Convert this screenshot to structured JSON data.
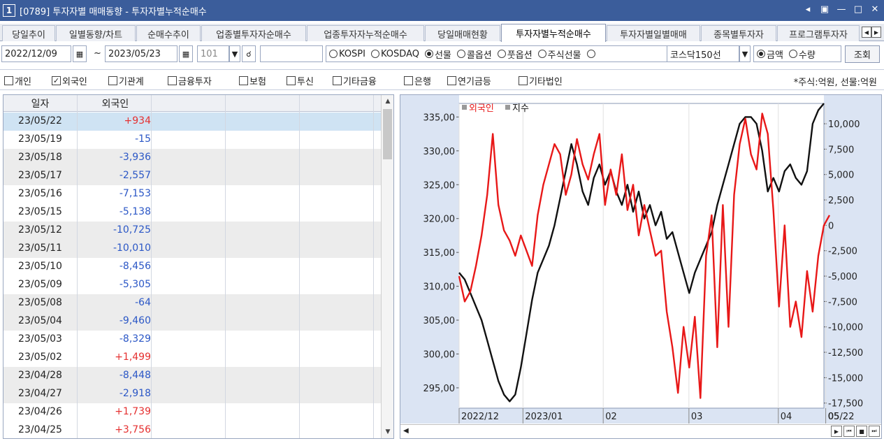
{
  "window": {
    "number": "1",
    "title": "[0789] 투자자별 매매동향 - 투자자별누적순매수"
  },
  "tabs": [
    {
      "label": "당일추이"
    },
    {
      "label": "일별동향/차트"
    },
    {
      "label": "순매수추이"
    },
    {
      "label": "업종별투자자순매수"
    },
    {
      "label": "업종투자자누적순매수"
    },
    {
      "label": "당일매매현황"
    },
    {
      "label": "투자자별누적순매수",
      "active": true
    },
    {
      "label": "투자자별일별매매"
    },
    {
      "label": "종목별투자자"
    },
    {
      "label": "프로그램투자자"
    }
  ],
  "conditions": {
    "start_date": "2022/12/09",
    "tilde": "~",
    "end_date": "2023/05/23",
    "code": "101",
    "market_options": [
      {
        "label": "KOSPI",
        "checked": false
      },
      {
        "label": "KOSDAQ",
        "checked": false
      },
      {
        "label": "선물",
        "checked": true
      },
      {
        "label": "콜옵션",
        "checked": false
      },
      {
        "label": "풋옵션",
        "checked": false
      },
      {
        "label": "주식선물",
        "checked": false
      },
      {
        "label": "",
        "checked": false
      }
    ],
    "futures_select": "코스닥150선",
    "measure_options": [
      {
        "label": "금액",
        "checked": true
      },
      {
        "label": "수량",
        "checked": false
      }
    ],
    "query_label": "조회"
  },
  "investors": [
    {
      "label": "개인",
      "checked": false
    },
    {
      "label": "외국인",
      "checked": true
    },
    {
      "label": "기관계",
      "checked": false
    },
    {
      "label": "금융투자",
      "checked": false
    },
    {
      "label": "보험",
      "checked": false
    },
    {
      "label": "투신",
      "checked": false
    },
    {
      "label": "기타금융",
      "checked": false
    },
    {
      "label": "은행",
      "checked": false
    },
    {
      "label": "연기금등",
      "checked": false
    },
    {
      "label": "기타법인",
      "checked": false
    }
  ],
  "unit_text": "*주식:억원, 선물:억원",
  "table": {
    "headers": [
      "일자",
      "외국인"
    ],
    "rows": [
      {
        "date": "23/05/22",
        "value": "+934"
      },
      {
        "date": "23/05/19",
        "value": "-15"
      },
      {
        "date": "23/05/18",
        "value": "-3,936"
      },
      {
        "date": "23/05/17",
        "value": "-2,557"
      },
      {
        "date": "23/05/16",
        "value": "-7,153"
      },
      {
        "date": "23/05/15",
        "value": "-5,138"
      },
      {
        "date": "23/05/12",
        "value": "-10,725"
      },
      {
        "date": "23/05/11",
        "value": "-10,010"
      },
      {
        "date": "23/05/10",
        "value": "-8,456"
      },
      {
        "date": "23/05/09",
        "value": "-5,305"
      },
      {
        "date": "23/05/08",
        "value": "-64"
      },
      {
        "date": "23/05/04",
        "value": "-9,460"
      },
      {
        "date": "23/05/03",
        "value": "-8,329"
      },
      {
        "date": "23/05/02",
        "value": "+1,499"
      },
      {
        "date": "23/04/28",
        "value": "-8,448"
      },
      {
        "date": "23/04/27",
        "value": "-2,918"
      },
      {
        "date": "23/04/26",
        "value": "+1,739"
      },
      {
        "date": "23/04/25",
        "value": "+3,756"
      }
    ]
  },
  "chart_data": {
    "type": "line",
    "legend": [
      "외국인",
      "지수"
    ],
    "colors": {
      "외국인": "#e81818",
      "지수": "#111111"
    },
    "left_axis": {
      "ticks": [
        "335,00",
        "330,00",
        "325,00",
        "320,00",
        "315,00",
        "310,00",
        "305,00",
        "300,00",
        "295,00"
      ],
      "range": [
        292,
        337
      ]
    },
    "right_axis": {
      "ticks": [
        "10,000",
        "7,500",
        "5,000",
        "2,500",
        "0",
        "-2,500",
        "-5,000",
        "-7,500",
        "-10,000",
        "-12,500",
        "-15,000",
        "-17,500"
      ],
      "range": [
        -18000,
        12000
      ]
    },
    "x_labels": [
      "2022/12",
      "2023/01",
      "02",
      "03",
      "04",
      "05",
      "05/22"
    ],
    "series": [
      {
        "name": "지수",
        "axis": "left",
        "values": [
          312,
          311,
          309,
          307,
          305,
          302,
          299,
          296,
          294,
          293,
          294,
          298,
          303,
          308,
          312,
          314,
          316,
          319,
          323,
          327,
          331,
          328,
          324,
          322,
          326,
          328,
          325,
          327,
          324,
          322,
          325,
          321,
          324,
          320,
          322,
          319,
          321,
          317,
          318,
          315,
          312,
          309,
          312,
          314,
          316,
          318,
          322,
          325,
          328,
          331,
          334,
          335,
          335,
          334,
          330,
          324,
          326,
          324,
          327,
          328,
          326,
          325,
          327,
          334,
          336,
          337
        ]
      },
      {
        "name": "외국인",
        "axis": "right",
        "values": [
          -5000,
          -7500,
          -6500,
          -4000,
          -1000,
          3000,
          9000,
          2000,
          -500,
          -1500,
          -3000,
          -1000,
          -2500,
          -4000,
          1000,
          4000,
          6000,
          8000,
          7000,
          3000,
          5000,
          8500,
          6000,
          4500,
          7000,
          9000,
          2000,
          5500,
          3000,
          7000,
          1500,
          4000,
          -1000,
          2000,
          -500,
          -3000,
          -2500,
          -8500,
          -12000,
          -16500,
          -10000,
          -14000,
          -9000,
          -17000,
          -3000,
          1000,
          -12000,
          2000,
          -10000,
          3000,
          8000,
          10500,
          7000,
          5500,
          11000,
          9000,
          1500,
          -8000,
          0,
          -10000,
          -7500,
          -11000,
          -4500,
          -8500,
          -3000,
          0,
          1000
        ]
      }
    ]
  }
}
